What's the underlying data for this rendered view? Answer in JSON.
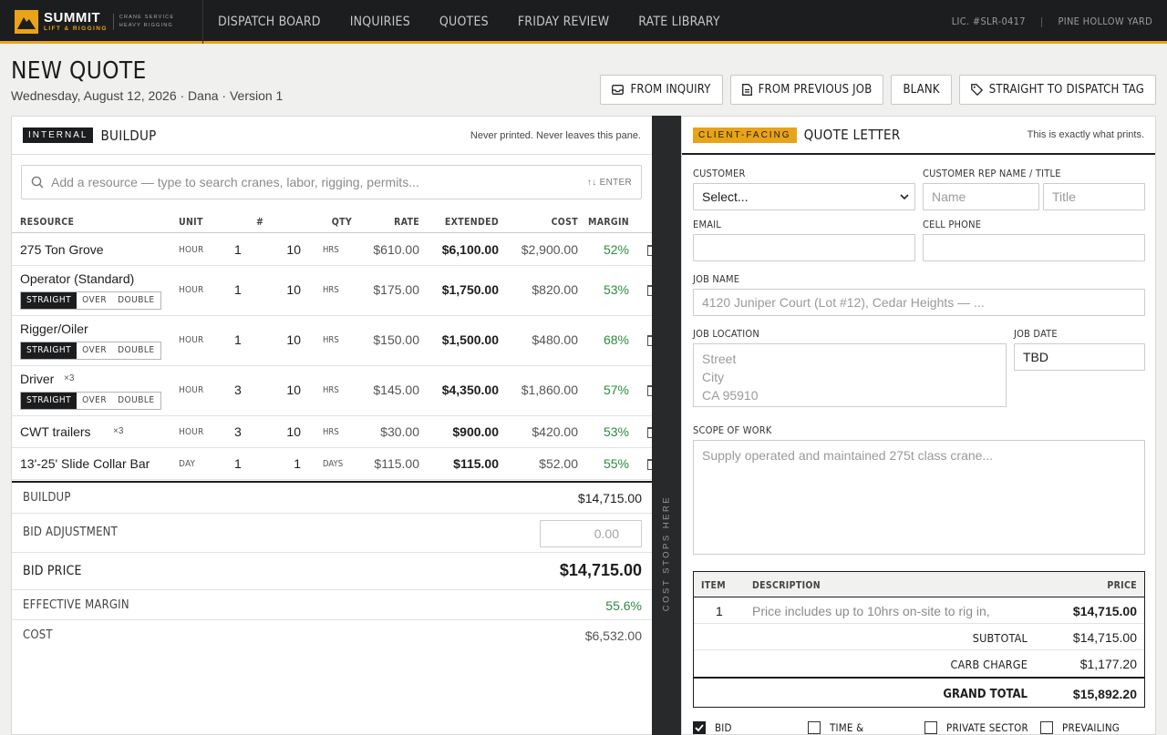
{
  "brand": {
    "name": "SUMMIT",
    "sub": "LIFT & RIGGING",
    "tag1": "CRANE SERVICE",
    "tag2": "HEAVY RIGGING",
    "accent": "#e8a317"
  },
  "nav": [
    {
      "label": "DISPATCH BOARD"
    },
    {
      "label": "INQUIRIES"
    },
    {
      "label": "QUOTES"
    },
    {
      "label": "FRIDAY REVIEW"
    },
    {
      "label": "RATE LIBRARY"
    }
  ],
  "topright": {
    "license": "LIC. #SLR-0417",
    "sep": "|",
    "yard": "PINE HOLLOW YARD"
  },
  "header": {
    "title": "NEW QUOTE",
    "subtitle": "Wednesday, August 12, 2026 · Dana · Version 1"
  },
  "actions": [
    {
      "label": "FROM INQUIRY",
      "icon": "inbox-icon"
    },
    {
      "label": "FROM PREVIOUS JOB",
      "icon": "document-icon"
    },
    {
      "label": "BLANK"
    },
    {
      "label": "STRAIGHT TO DISPATCH TAG",
      "icon": "tag-icon"
    }
  ],
  "left": {
    "badge": "INTERNAL",
    "title": "BUILDUP",
    "note": "Never printed. Never leaves this pane.",
    "search": {
      "placeholder": "Add a resource — type to search cranes, labor, rigging, permits...",
      "hint": "↑↓ ENTER"
    },
    "columns": {
      "resource": "RESOURCE",
      "unit": "UNIT",
      "num": "#",
      "qty": "QTY",
      "rate": "RATE",
      "extended": "EXTENDED",
      "cost": "COST",
      "margin": "MARGIN"
    },
    "rows": [
      {
        "name": "275 Ton Grove",
        "mult": "",
        "unit": "HOUR",
        "num": "1",
        "qty": "10",
        "qty_unit": "HRS",
        "rate": "$610.00",
        "ext": "$6,100.00",
        "cost": "$2,900.00",
        "margin": "52%",
        "seg": null
      },
      {
        "name": "Operator (Standard)",
        "mult": "",
        "unit": "HOUR",
        "num": "1",
        "qty": "10",
        "qty_unit": "HRS",
        "rate": "$175.00",
        "ext": "$1,750.00",
        "cost": "$820.00",
        "margin": "53%",
        "seg": [
          "STRAIGHT",
          "OVER",
          "DOUBLE"
        ]
      },
      {
        "name": "Rigger/Oiler",
        "mult": "",
        "unit": "HOUR",
        "num": "1",
        "qty": "10",
        "qty_unit": "HRS",
        "rate": "$150.00",
        "ext": "$1,500.00",
        "cost": "$480.00",
        "margin": "68%",
        "seg": [
          "STRAIGHT",
          "OVER",
          "DOUBLE"
        ]
      },
      {
        "name": "Driver",
        "mult": "×3",
        "unit": "HOUR",
        "num": "3",
        "qty": "10",
        "qty_unit": "HRS",
        "rate": "$145.00",
        "ext": "$4,350.00",
        "cost": "$1,860.00",
        "margin": "57%",
        "seg": [
          "STRAIGHT",
          "OVER",
          "DOUBLE"
        ]
      },
      {
        "name": "CWT trailers",
        "mult": "×3",
        "unit": "HOUR",
        "num": "3",
        "qty": "10",
        "qty_unit": "HRS",
        "rate": "$30.00",
        "ext": "$900.00",
        "cost": "$420.00",
        "margin": "53%",
        "seg": null
      },
      {
        "name": "13'-25' Slide Collar Bar",
        "mult": "",
        "unit": "DAY",
        "num": "1",
        "qty": "1",
        "qty_unit": "DAYS",
        "rate": "$115.00",
        "ext": "$115.00",
        "cost": "$52.00",
        "margin": "55%",
        "seg": null
      }
    ],
    "totals": {
      "buildup_label": "BUILDUP",
      "buildup": "$14,715.00",
      "adj_label": "BID ADJUSTMENT",
      "adj_currency": "$",
      "adj_placeholder": "0.00",
      "bid_label": "BID PRICE",
      "bid": "$14,715.00",
      "eff_label": "EFFECTIVE MARGIN",
      "eff": "55.6%",
      "cost_label": "COST",
      "cost": "$6,532.00"
    }
  },
  "divider": {
    "label": "COST STOPS HERE"
  },
  "right": {
    "badge": "CLIENT-FACING",
    "title": "QUOTE LETTER",
    "note": "This is exactly what prints.",
    "customer_label": "CUSTOMER",
    "customer_value": "Select...",
    "rep_label": "CUSTOMER REP NAME / TITLE",
    "rep_name_ph": "Name",
    "rep_title_ph": "Title",
    "email_label": "EMAIL",
    "phone_label": "CELL PHONE",
    "job_name_label": "JOB NAME",
    "job_name_ph": "4120 Juniper Court (Lot #12), Cedar Heights — ...",
    "job_loc_label": "JOB LOCATION",
    "job_loc_street": "Street",
    "job_loc_city": "City",
    "job_loc_state": "CA 95910",
    "job_date_label": "JOB DATE",
    "job_date": "TBD",
    "scope_label": "SCOPE OF WORK",
    "scope_ph": "Supply operated and maintained 275t class crane...",
    "items_cols": {
      "item": "ITEM",
      "desc": "DESCRIPTION",
      "price": "PRICE"
    },
    "items": [
      {
        "item": "1",
        "desc": "Price includes up to 10hrs on-site to rig in,",
        "price": "$14,715.00"
      }
    ],
    "subtotal_label": "SUBTOTAL",
    "subtotal": "$14,715.00",
    "carb_label": "CARB CHARGE",
    "carb": "$1,177.20",
    "grand_label": "GRAND TOTAL",
    "grand": "$15,892.20",
    "checks": [
      {
        "label": "BID",
        "on": true
      },
      {
        "label": "TIME &",
        "on": false
      },
      {
        "label": "PRIVATE SECTOR",
        "on": false
      },
      {
        "label": "PREVAILING",
        "on": false
      }
    ]
  }
}
